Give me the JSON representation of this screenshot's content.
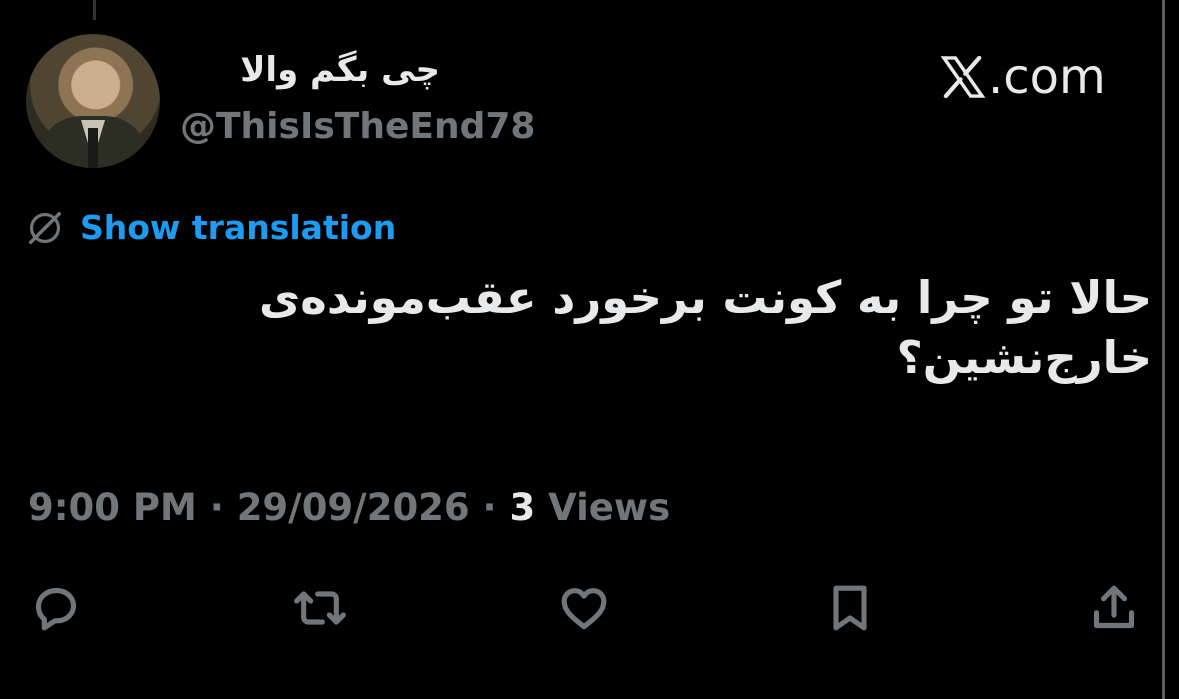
{
  "author": {
    "display_name": "چی بگم والا",
    "handle": "@ThisIsTheEnd78",
    "avatar": "profile-photo"
  },
  "brand": {
    "logo_icon": "x-logo-icon",
    "domain": ".com"
  },
  "translation": {
    "icon": "globe-slash-icon",
    "label": "Show translation"
  },
  "tweet": {
    "text": "حالا تو چرا به کونت برخورد عقب‌مونده‌ی خارج‌نشین؟"
  },
  "meta": {
    "time": "9:00 PM",
    "sep1": " · ",
    "date": "29/09/2026",
    "sep2": " · ",
    "views_count": "3",
    "views_label": " Views"
  },
  "actions": [
    {
      "name": "reply",
      "icon": "reply-icon"
    },
    {
      "name": "repost",
      "icon": "repost-icon"
    },
    {
      "name": "like",
      "icon": "heart-icon"
    },
    {
      "name": "bookmark",
      "icon": "bookmark-icon"
    },
    {
      "name": "share",
      "icon": "share-icon"
    }
  ],
  "colors": {
    "background": "#000000",
    "text": "#e7e9ea",
    "muted": "#71767b",
    "link": "#1d9bf0"
  }
}
